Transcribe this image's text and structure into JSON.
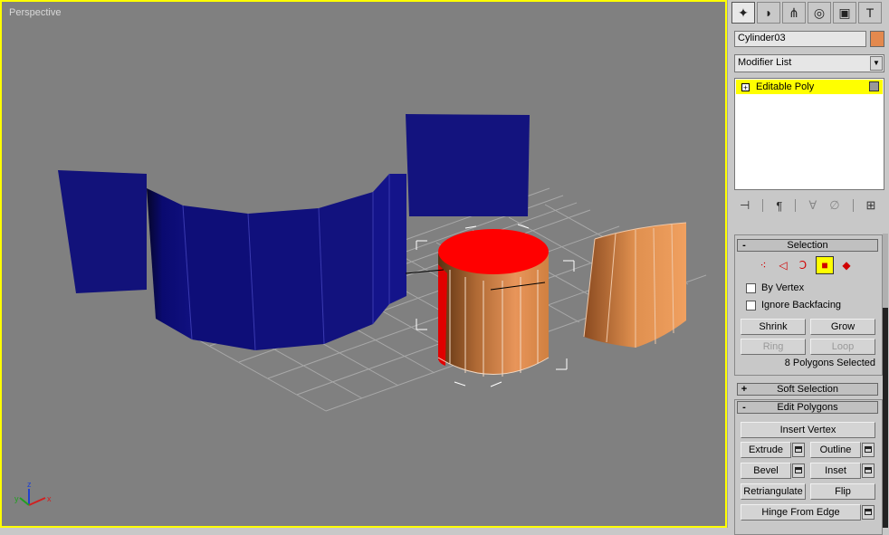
{
  "viewport": {
    "label": "Perspective",
    "axis": {
      "x": "x",
      "y": "y",
      "z": "z"
    }
  },
  "command_panel": {
    "tabs": [
      {
        "name": "create",
        "glyph": "✦"
      },
      {
        "name": "modify",
        "glyph": "◗"
      },
      {
        "name": "hierarchy",
        "glyph": "⋔"
      },
      {
        "name": "motion",
        "glyph": "◎"
      },
      {
        "name": "display",
        "glyph": "▣"
      },
      {
        "name": "utilities",
        "glyph": "T"
      }
    ],
    "object_name": "Cylinder03",
    "object_color": "#e3894e",
    "modifier_list": "Modifier List",
    "stack_item": "Editable Poly"
  },
  "selection": {
    "title": "Selection",
    "sign": "-",
    "by_vertex": "By Vertex",
    "ignore_backfacing": "Ignore Backfacing",
    "shrink": "Shrink",
    "grow": "Grow",
    "ring": "Ring",
    "loop": "Loop",
    "status": "8 Polygons Selected"
  },
  "soft_selection": {
    "title": "Soft Selection",
    "sign": "+"
  },
  "edit_polygons": {
    "title": "Edit Polygons",
    "sign": "-",
    "insert_vertex": "Insert Vertex",
    "extrude": "Extrude",
    "outline": "Outline",
    "bevel": "Bevel",
    "inset": "Inset",
    "retriangulate": "Retriangulate",
    "flip": "Flip",
    "hinge_from_edge": "Hinge From Edge"
  }
}
